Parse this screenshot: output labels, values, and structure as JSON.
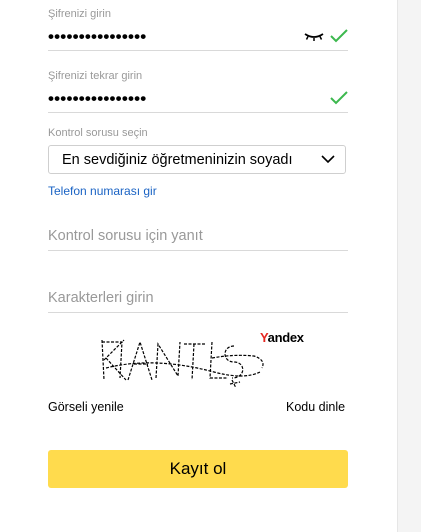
{
  "password": {
    "label": "Şifrenizi girin",
    "masked_value": "••••••••••••••••",
    "visibility_icon": "eye-closed-icon",
    "valid_icon": "check-icon"
  },
  "password_repeat": {
    "label": "Şifrenizi tekrar girin",
    "masked_value": "••••••••••••••••",
    "valid_icon": "check-icon"
  },
  "security_question": {
    "label": "Kontrol sorusu seçin",
    "selected": "En sevdiğiniz öğretmeninizin soyadı"
  },
  "phone_link": "Telefon numarası gir",
  "answer_field": {
    "placeholder": "Kontrol sorusu için yanıt",
    "value": ""
  },
  "captcha_field": {
    "placeholder": "Karakterleri girin",
    "value": ""
  },
  "captcha": {
    "brand_first": "Y",
    "brand_rest": "andex",
    "refresh_label": "Görseli yenile",
    "audio_label": "Kodu dinle"
  },
  "submit_label": "Kayıt ol",
  "colors": {
    "accent_yellow": "#ffdb4d",
    "valid_green": "#3cb84e",
    "link_blue": "#1a63c4"
  }
}
